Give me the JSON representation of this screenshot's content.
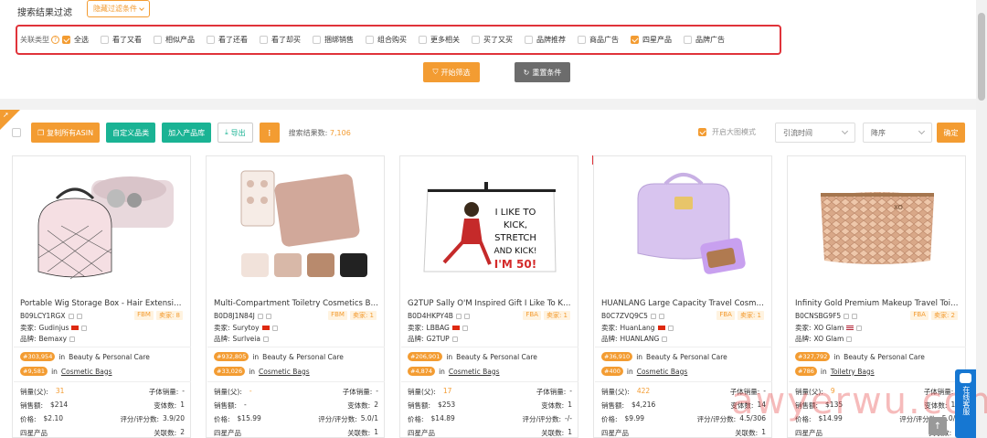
{
  "filter": {
    "title": "搜索结果过滤",
    "hide_button": "隐藏过滤条件",
    "assoc_label": "关联类型",
    "options": [
      {
        "label": "全选",
        "checked": true
      },
      {
        "label": "看了又看",
        "checked": false
      },
      {
        "label": "相似产品",
        "checked": false
      },
      {
        "label": "看了还看",
        "checked": false
      },
      {
        "label": "看了却买",
        "checked": false
      },
      {
        "label": "捆绑销售",
        "checked": false
      },
      {
        "label": "组合购买",
        "checked": false
      },
      {
        "label": "更多相关",
        "checked": false
      },
      {
        "label": "买了又买",
        "checked": false
      },
      {
        "label": "品牌推荐",
        "checked": false
      },
      {
        "label": "商品广告",
        "checked": false
      },
      {
        "label": "四星产品",
        "checked": true
      },
      {
        "label": "品牌广告",
        "checked": false
      }
    ],
    "start_button": "开始筛选",
    "reset_button": "重置条件"
  },
  "toolbar": {
    "copy_asin": "复制所有ASIN",
    "custom_category": "自定义品类",
    "add_library": "加入产品库",
    "export": "导出",
    "more": "⋮",
    "result_label": "搜索结果数:",
    "result_count": "7,106",
    "bigimg_label": "开启大图模式",
    "sort_field": "引流时间",
    "sort_order": "降序",
    "confirm": "确定"
  },
  "labels": {
    "seller": "卖家:",
    "brand": "品牌:",
    "sales": "销量(父):",
    "sub_sales": "子体销量:",
    "revenue": "销售额:",
    "variants": "变体数:",
    "price": "价格:",
    "rating": "评分/评分数:",
    "four_star": "四星产品",
    "assoc_count": "关联数:",
    "in": "in"
  },
  "products": [
    {
      "title": "Portable Wig Storage Box - Hair Extension...",
      "asin": "B09LCY1RGX",
      "fulfil": "FBM",
      "seller_count": "卖家: 8",
      "seller": "Gudinjus",
      "seller_flag": "cn",
      "brand": "Bemaxy",
      "rank1": "#303,954",
      "cat1": "Beauty & Personal Care",
      "rank2": "#9,581",
      "cat2": "Cosmetic Bags",
      "sales": "31",
      "sub_sales": "-",
      "revenue": "$214",
      "variants": "1",
      "price": "$2.10",
      "rating": "3.9/20",
      "assoc": "2"
    },
    {
      "title": "Multi-Compartment Toiletry Cosmetics Ba...",
      "asin": "B0D8J1N84J",
      "fulfil": "FBM",
      "seller_count": "卖家: 1",
      "seller": "Surytoy",
      "seller_flag": "cn",
      "brand": "Surlveia",
      "rank1": "#932,805",
      "cat1": "Beauty & Personal Care",
      "rank2": "#33,026",
      "cat2": "Cosmetic Bags",
      "sales": "-",
      "sub_sales": "-",
      "revenue": "-",
      "variants": "2",
      "price": "$15.99",
      "rating": "5.0/1",
      "assoc": "1"
    },
    {
      "title": "G2TUP Sally O'M Inspired Gift I Like To Kic...",
      "asin": "B0D4HKPY4B",
      "fulfil": "FBA",
      "seller_count": "卖家: 1",
      "seller": "LBBAG",
      "seller_flag": "cn",
      "brand": "G2TUP",
      "rank1": "#206,901",
      "cat1": "Beauty & Personal Care",
      "rank2": "#4,874",
      "cat2": "Cosmetic Bags",
      "sales": "17",
      "sub_sales": "-",
      "revenue": "$253",
      "variants": "1",
      "price": "$14.89",
      "rating": "-/-",
      "assoc": "1"
    },
    {
      "title": "HUANLANG Large Capacity Travel Cosmeti...",
      "asin": "B0C7ZVQ9C5",
      "fulfil": "FBA",
      "seller_count": "卖家: 1",
      "seller": "HuanLang",
      "seller_flag": "cn",
      "brand": "HUANLANG",
      "rank1": "#36,910",
      "cat1": "Beauty & Personal Care",
      "rank2": "#400",
      "cat2": "Cosmetic Bags",
      "sales": "422",
      "sub_sales": "-",
      "revenue": "$4,216",
      "variants": "14",
      "price": "$9.99",
      "rating": "4.5/306",
      "assoc": "1"
    },
    {
      "title": "Infinity Gold Premium Makeup Travel Toile...",
      "asin": "B0CNSBG9F5",
      "fulfil": "FBA",
      "seller_count": "卖家: 2",
      "seller": "XO Glam",
      "seller_flag": "us",
      "brand": "XO Glam",
      "rank1": "#327,792",
      "cat1": "Beauty & Personal Care",
      "rank2": "#786",
      "cat2": "Toiletry Bags",
      "sales": "9",
      "sub_sales": "-",
      "revenue": "$135",
      "variants": "16",
      "price": "$14.99",
      "rating": "5.0/2",
      "assoc": "3"
    }
  ],
  "aplus_badge": "A+",
  "chat": {
    "label": "在线客服"
  },
  "watermark": "awyerwu.com",
  "colors": {
    "accent": "#f39c32",
    "teal": "#1ab394",
    "highlight": "#e0333a"
  },
  "icons": [
    "help-icon",
    "chevron-down-icon",
    "filter-icon",
    "refresh-icon",
    "copy-icon",
    "download-icon",
    "more-icon",
    "chat-icon",
    "arrow-up-icon"
  ]
}
